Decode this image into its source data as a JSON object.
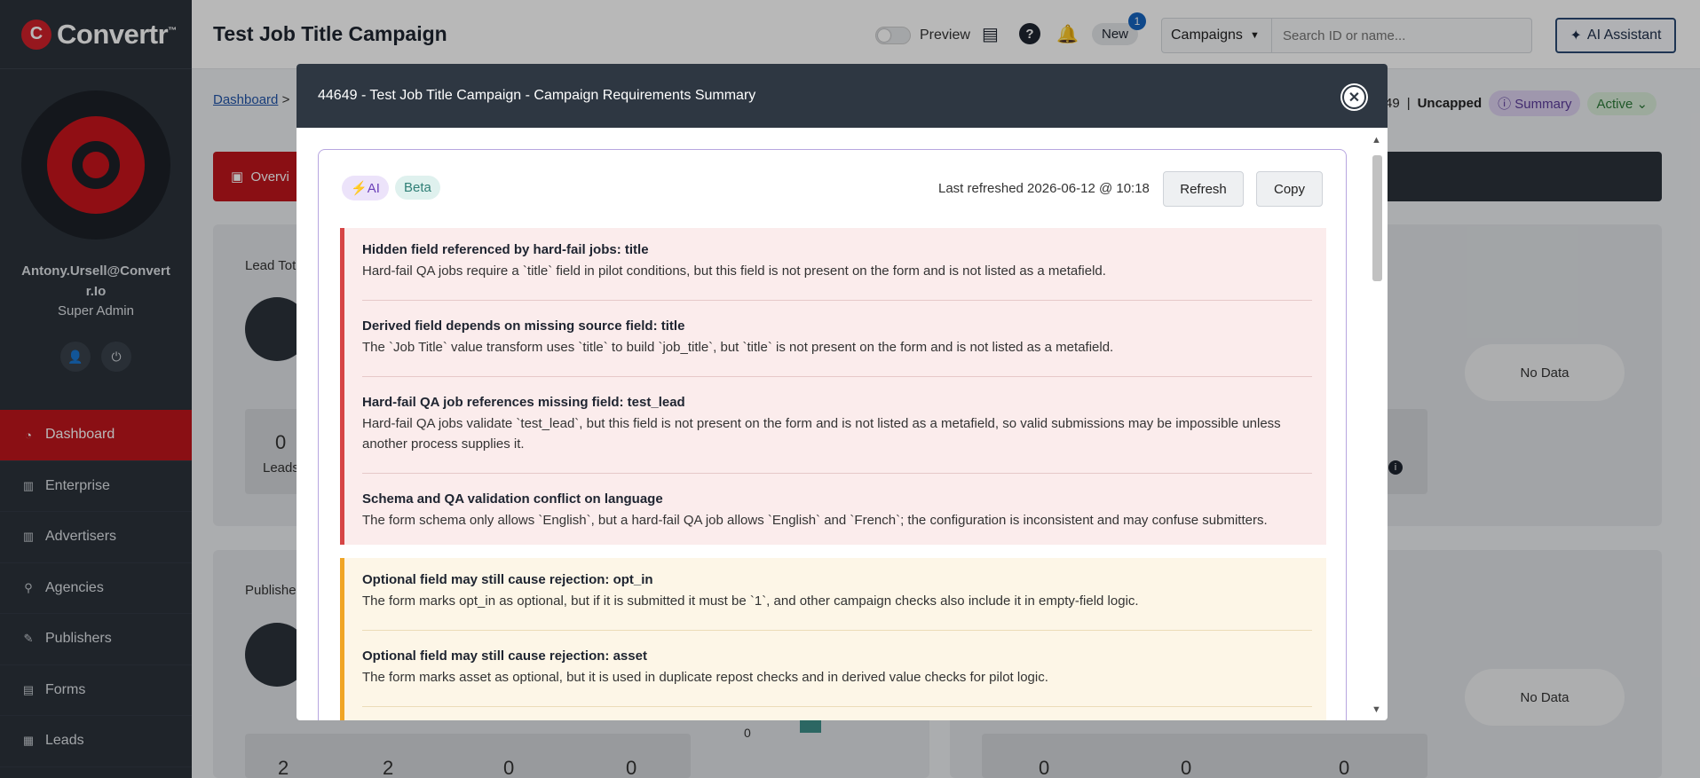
{
  "app": {
    "logo_text": "Convertr",
    "logo_mark": "C",
    "trademark": "™"
  },
  "sidebar": {
    "user_email": "Antony.Ursell@Convertr.Io",
    "user_role": "Super Admin",
    "items": [
      {
        "label": "Dashboard",
        "icon": "dashboard-icon",
        "glyph": "◔",
        "active": true
      },
      {
        "label": "Enterprise",
        "icon": "building-icon",
        "glyph": "▥",
        "active": false
      },
      {
        "label": "Advertisers",
        "icon": "building-icon",
        "glyph": "▥",
        "active": false
      },
      {
        "label": "Agencies",
        "icon": "agencies-icon",
        "glyph": "⚲",
        "active": false
      },
      {
        "label": "Publishers",
        "icon": "publishers-icon",
        "glyph": "✎",
        "active": false
      },
      {
        "label": "Forms",
        "icon": "forms-icon",
        "glyph": "▤",
        "active": false
      },
      {
        "label": "Leads",
        "icon": "leads-icon",
        "glyph": "▦",
        "active": false
      }
    ]
  },
  "header": {
    "page_title": "Test Job Title Campaign",
    "preview_label": "Preview",
    "new_label": "New",
    "new_badge_count": "1",
    "campaigns_select": "Campaigns",
    "search_placeholder": "Search ID or name...",
    "ai_assistant_label": "AI Assistant"
  },
  "background": {
    "breadcrumb_link": "Dashboard",
    "breadcrumb_sep": ">",
    "id_suffix": "49",
    "uncapped": "Uncapped",
    "summary_pill": "Summary",
    "active_pill": "Active",
    "overview_tab": "Overvi",
    "lead_tot_label": "Lead Tot",
    "leads_label": "Leads",
    "publisher_label": "Publishe",
    "zero": "0",
    "two": "2",
    "axis_zero": "0",
    "no_data": "No Data"
  },
  "modal": {
    "title": "44649 - Test Job Title Campaign - Campaign Requirements Summary",
    "badge_ai": "AI",
    "badge_beta": "Beta",
    "last_refreshed": "Last refreshed 2026-06-12 @ 10:18",
    "refresh_label": "Refresh",
    "copy_label": "Copy",
    "critical_issues": [
      {
        "title": "Hidden field referenced by hard-fail jobs: title",
        "desc": "Hard-fail QA jobs require a `title` field in pilot conditions, but this field is not present on the form and is not listed as a metafield."
      },
      {
        "title": "Derived field depends on missing source field: title",
        "desc": "The `Job Title` value transform uses `title` to build `job_title`, but `title` is not present on the form and is not listed as a metafield."
      },
      {
        "title": "Hard-fail QA job references missing field: test_lead",
        "desc": "Hard-fail QA jobs validate `test_lead`, but this field is not present on the form and is not listed as a metafield, so valid submissions may be impossible unless another process supplies it."
      },
      {
        "title": "Schema and QA validation conflict on language",
        "desc": "The form schema only allows `English`, but a hard-fail QA job allows `English` and `French`; the configuration is inconsistent and may confuse submitters."
      }
    ],
    "warning_issues": [
      {
        "title": "Optional field may still cause rejection: opt_in",
        "desc": "The form marks opt_in as optional, but if it is submitted it must be `1`, and other campaign checks also include it in empty-field logic."
      },
      {
        "title": "Optional field may still cause rejection: asset",
        "desc": "The form marks asset as optional, but it is used in duplicate repost checks and in derived value checks for pilot logic."
      }
    ]
  },
  "colors": {
    "brand_red": "#c0151d",
    "sidebar_bg": "#2b323b",
    "critical_border": "#d64545",
    "warning_border": "#f0a526"
  }
}
